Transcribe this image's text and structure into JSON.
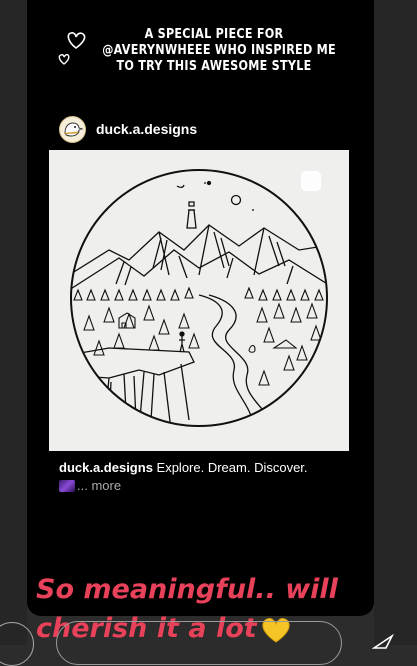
{
  "story": {
    "header_lines": [
      "A SPECIAL PIECE FOR",
      "@AVERYNWHEEE WHO INSPIRED ME",
      "TO TRY THIS AWESOME STYLE"
    ],
    "sticker_line1": "So meaningful.. will",
    "sticker_line2": "cherish it a lot"
  },
  "post": {
    "username": "duck.a.designs",
    "caption_user": "duck.a.designs",
    "caption_text": " Explore. Dream. Discover.",
    "more_label": "... more"
  },
  "icons": [
    "heart-outline-icon",
    "yellow-heart-emoji",
    "galaxy-emoji",
    "send-icon"
  ],
  "colors": {
    "sticker": "#e8425a",
    "background": "#000000"
  }
}
